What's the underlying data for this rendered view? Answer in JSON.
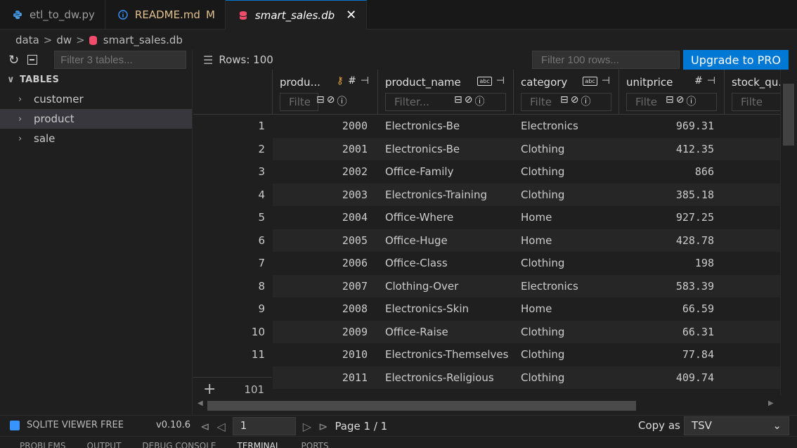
{
  "tabs": [
    {
      "name": "etl_to_dw.py",
      "icon": "python-icon"
    },
    {
      "name": "README.md",
      "icon": "info-icon",
      "badge": "M"
    },
    {
      "name": "smart_sales.db",
      "icon": "database-icon",
      "close": "✕"
    }
  ],
  "breadcrumb": {
    "items": [
      "data",
      "dw",
      "smart_sales.db"
    ]
  },
  "sidebar": {
    "filter_placeholder": "Filter 3 tables...",
    "section_title": "TABLES",
    "items": [
      "customer",
      "product",
      "sale"
    ]
  },
  "toolbar": {
    "rows_label": "Rows: 100",
    "row_filter_placeholder": "Filter 100 rows...",
    "upgrade_label": "Upgrade to PRO"
  },
  "columns": [
    {
      "name": "produ...",
      "filter": "Filte"
    },
    {
      "name": "product_name",
      "filter": "Filter..."
    },
    {
      "name": "category",
      "filter": "Filte"
    },
    {
      "name": "unitprice",
      "filter": "Filte"
    },
    {
      "name": "stock_qu...",
      "filter": "Filte"
    }
  ],
  "rows": [
    {
      "n": "1",
      "id": "2000",
      "name": "Electronics-Be",
      "cat": "Electronics",
      "price": "969.31"
    },
    {
      "n": "2",
      "id": "2001",
      "name": "Electronics-Be",
      "cat": "Clothing",
      "price": "412.35"
    },
    {
      "n": "3",
      "id": "2002",
      "name": "Office-Family",
      "cat": "Clothing",
      "price": "866"
    },
    {
      "n": "4",
      "id": "2003",
      "name": "Electronics-Training",
      "cat": "Clothing",
      "price": "385.18"
    },
    {
      "n": "5",
      "id": "2004",
      "name": "Office-Where",
      "cat": "Home",
      "price": "927.25"
    },
    {
      "n": "6",
      "id": "2005",
      "name": "Office-Huge",
      "cat": "Home",
      "price": "428.78"
    },
    {
      "n": "7",
      "id": "2006",
      "name": "Office-Class",
      "cat": "Clothing",
      "price": "198"
    },
    {
      "n": "8",
      "id": "2007",
      "name": "Clothing-Over",
      "cat": "Electronics",
      "price": "583.39"
    },
    {
      "n": "9",
      "id": "2008",
      "name": "Electronics-Skin",
      "cat": "Home",
      "price": "66.59"
    },
    {
      "n": "10",
      "id": "2009",
      "name": "Office-Raise",
      "cat": "Clothing",
      "price": "66.31"
    },
    {
      "n": "11",
      "id": "2010",
      "name": "Electronics-Themselves",
      "cat": "Clothing",
      "price": "77.84"
    },
    {
      "n": "",
      "id": "2011",
      "name": "Electronics-Religious",
      "cat": "Clothing",
      "price": "409.74"
    }
  ],
  "footer_row": {
    "count": "101"
  },
  "status": {
    "brand": "SQLITE VIEWER FREE",
    "version": "v0.10.6",
    "page_value": "1",
    "page_label": "Page 1 / 1",
    "copy_as_label": "Copy as",
    "copy_format": "TSV"
  },
  "panel_tabs": [
    "PROBLEMS",
    "OUTPUT",
    "DEBUG CONSOLE",
    "TERMINAL",
    "PORTS"
  ],
  "colors": {
    "accent": "#0078d4",
    "db_icon": "#f14c6c",
    "key_icon": "#e5a33a"
  }
}
